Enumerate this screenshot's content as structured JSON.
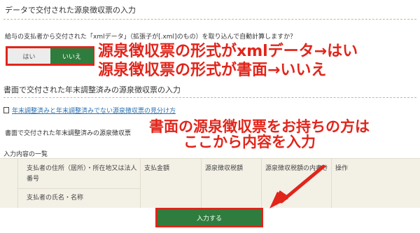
{
  "section1": {
    "title": "データで交付された源泉徴収票の入力",
    "question": "給与の支払者から交付された「xmlデータ」（拡張子が[.xml]のもの）を取り込んで自動計算しますか？",
    "yes_label": "はい",
    "no_label": "いいえ"
  },
  "annotations": {
    "line1": "源泉徴収票の形式がxmlデータ→はい",
    "line2": "源泉徴収票の形式が書面→いいえ",
    "line3": "書面の源泉徴収票をお持ちの方は",
    "line4": "ここから内容を入力"
  },
  "section2": {
    "title": "書面で交付された年末調整済みの源泉徴収票の入力",
    "link_text": "年末調整済みと年末調整済みでない源泉徴収票の見分け方",
    "label": "書面で交付された年末調整済みの源泉徴収票",
    "list_label": "入力内容の一覧"
  },
  "table": {
    "col1_line1": "支払者の住所（居所）・所在地又は法人",
    "col1_line2": "番号",
    "col1_line3": "支払者の氏名・名称",
    "col2": "支払金額",
    "col3": "源泉徴収税額",
    "col4": "源泉徴収税額の内書き",
    "col5": "操作"
  },
  "enter_button": "入力する",
  "colors": {
    "accent_red": "#e1251b",
    "button_green": "#2f7d3e"
  }
}
